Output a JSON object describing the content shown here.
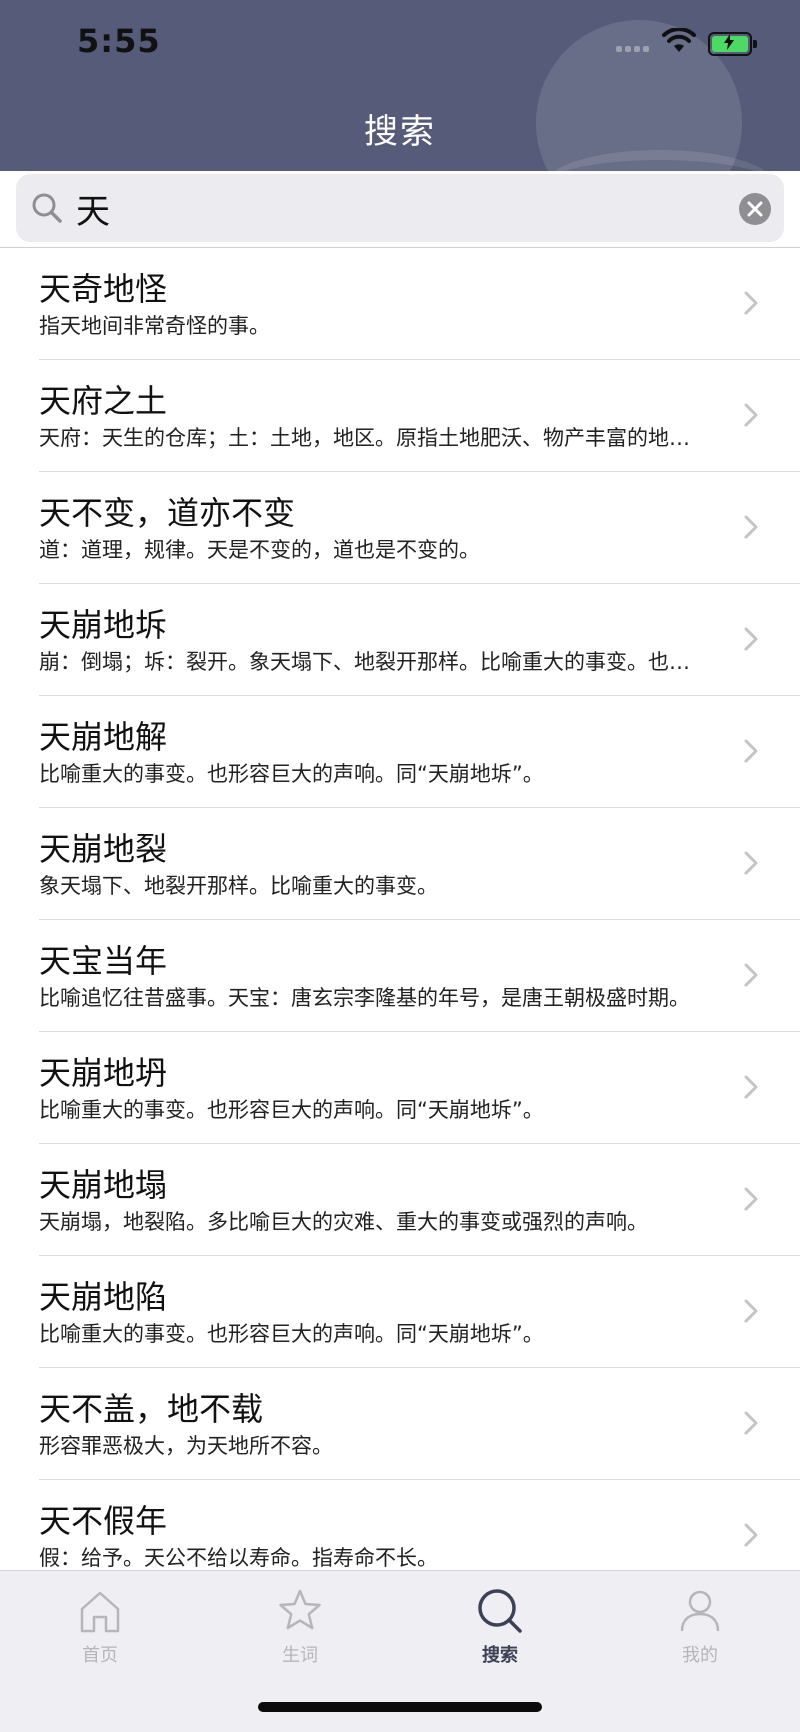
{
  "status_bar": {
    "time": "5:55"
  },
  "header": {
    "title": "搜索"
  },
  "search": {
    "value": "天"
  },
  "results": [
    {
      "title": "天奇地怪",
      "description": "指天地间非常奇怪的事。"
    },
    {
      "title": "天府之土",
      "description": "天府：天生的仓库；土：土地，地区。原指土地肥沃、物产丰富的地方。"
    },
    {
      "title": "天不变，道亦不变",
      "description": "道：道理，规律。天是不变的，道也是不变的。"
    },
    {
      "title": "天崩地坼",
      "description": "崩：倒塌；坼：裂开。象天塌下、地裂开那样。比喻重大的事变。也形容巨大的声响。"
    },
    {
      "title": "天崩地解",
      "description": "比喻重大的事变。也形容巨大的声响。同“天崩地坼”。"
    },
    {
      "title": "天崩地裂",
      "description": "象天塌下、地裂开那样。比喻重大的事变。"
    },
    {
      "title": "天宝当年",
      "description": "比喻追忆往昔盛事。天宝：唐玄宗李隆基的年号，是唐王朝极盛时期。"
    },
    {
      "title": "天崩地坍",
      "description": "比喻重大的事变。也形容巨大的声响。同“天崩地坼”。"
    },
    {
      "title": "天崩地塌",
      "description": "天崩塌，地裂陷。多比喻巨大的灾难、重大的事变或强烈的声响。"
    },
    {
      "title": "天崩地陷",
      "description": "比喻重大的事变。也形容巨大的声响。同“天崩地坼”。"
    },
    {
      "title": "天不盖，地不载",
      "description": "形容罪恶极大，为天地所不容。"
    },
    {
      "title": "天不假年",
      "description": "假：给予。天公不给以寿命。指寿命不长。"
    }
  ],
  "tabbar": {
    "items": [
      {
        "label": "首页",
        "icon": "home-icon",
        "active": false
      },
      {
        "label": "生词",
        "icon": "star-icon",
        "active": false
      },
      {
        "label": "搜索",
        "icon": "search-icon",
        "active": true
      },
      {
        "label": "我的",
        "icon": "person-icon",
        "active": false
      }
    ]
  },
  "colors": {
    "header_bg": "#555b78",
    "active_tab": "#3d4157",
    "inactive_tab": "#b5b5ba"
  }
}
